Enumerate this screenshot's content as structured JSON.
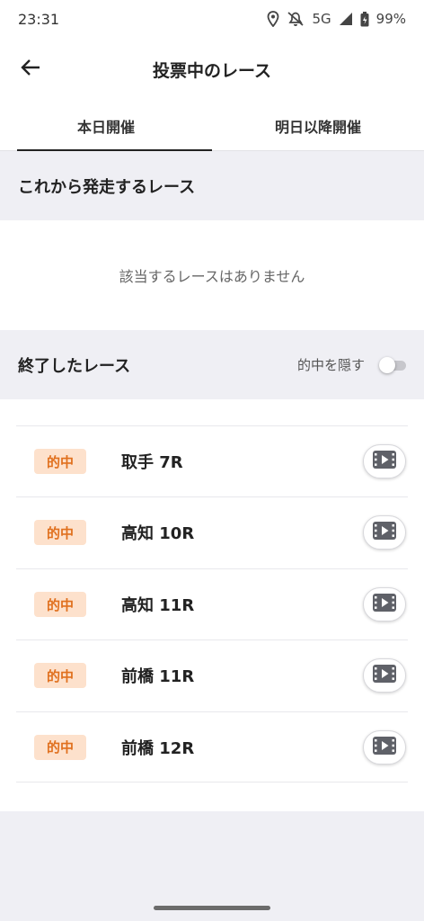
{
  "status_bar": {
    "time": "23:31",
    "network": "5G",
    "battery": "99%",
    "icons": [
      "location-icon",
      "mute-icon",
      "signal-icon",
      "battery-icon"
    ]
  },
  "header": {
    "title": "投票中のレース",
    "back_icon": "back-arrow-icon"
  },
  "tabs": [
    {
      "label": "本日開催",
      "active": true
    },
    {
      "label": "明日以降開催",
      "active": false
    }
  ],
  "upcoming": {
    "title": "これから発走するレース",
    "empty_message": "該当するレースはありません"
  },
  "finished": {
    "title": "終了したレース",
    "toggle_label": "的中を隠す",
    "toggle_on": false,
    "races": [
      {
        "badge": "的中",
        "name": "取手 7R"
      },
      {
        "badge": "的中",
        "name": "高知 10R"
      },
      {
        "badge": "的中",
        "name": "高知 11R"
      },
      {
        "badge": "的中",
        "name": "前橋 11R"
      },
      {
        "badge": "的中",
        "name": "前橋 12R"
      }
    ]
  },
  "colors": {
    "accent_text": "#e0701e",
    "badge_bg": "#fde1cc",
    "section_bg": "#efeff4"
  }
}
